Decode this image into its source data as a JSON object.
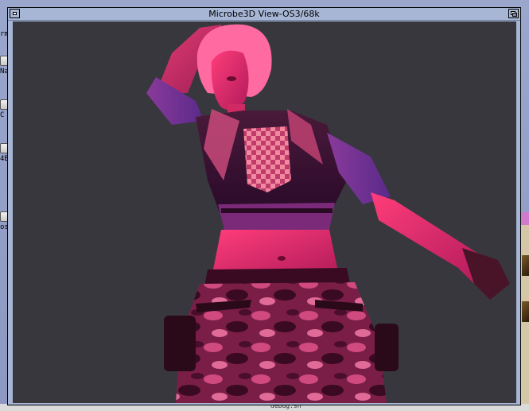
{
  "window": {
    "title": "Microbe3D View-OS3/68k"
  },
  "desktop": {
    "icons": [
      {
        "label": "rm"
      },
      {
        "label": "Na"
      },
      {
        "label": "C"
      },
      {
        "label": "4B"
      },
      {
        "label": "os"
      }
    ]
  },
  "taskbar": {
    "text": "debug.sh"
  },
  "icons": {
    "close": "close-icon",
    "depth": "depth-arrange-icon",
    "drive": "hard-drive-icon"
  }
}
